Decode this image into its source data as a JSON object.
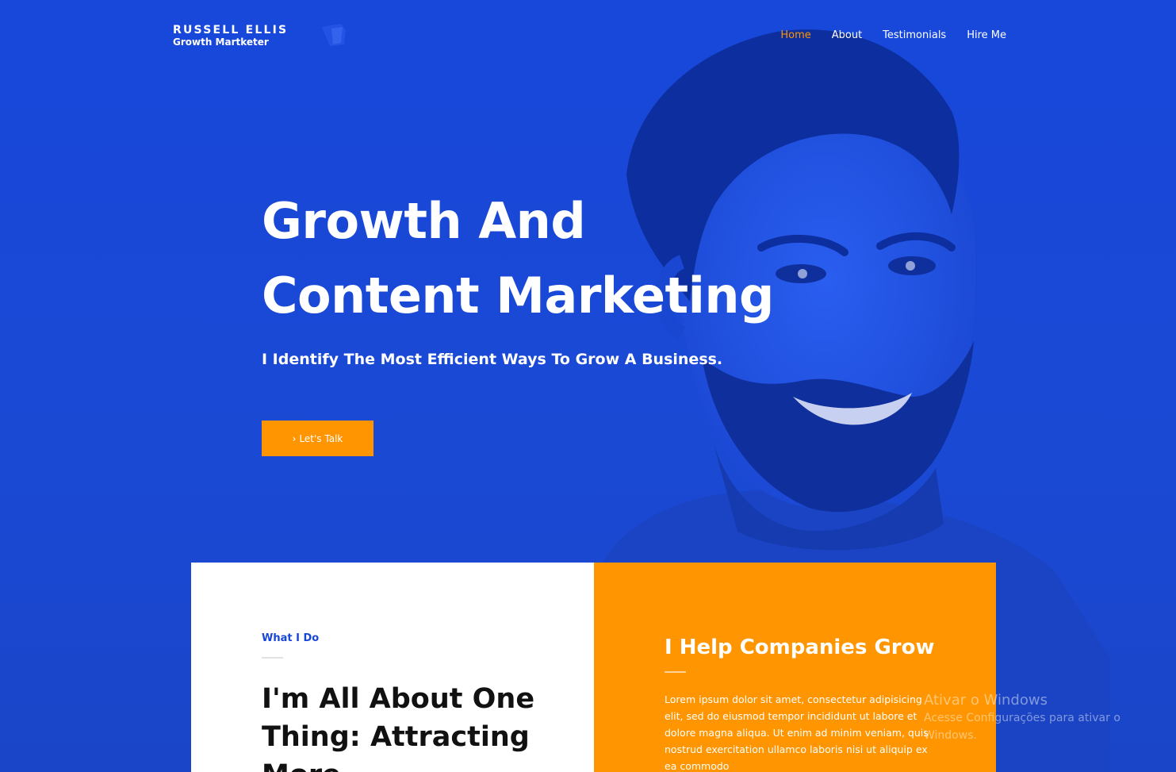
{
  "brand": {
    "name": "RUSSELL ELLIS",
    "tagline": "Growth Martketer"
  },
  "nav": {
    "items": [
      {
        "label": "Home",
        "active": true
      },
      {
        "label": "About",
        "active": false
      },
      {
        "label": "Testimonials",
        "active": false
      },
      {
        "label": "Hire Me",
        "active": false
      }
    ]
  },
  "hero": {
    "headline_line1": "Growth And",
    "headline_line2": "Content Marketing",
    "subheadline": "I Identify The Most Efficient Ways To Grow A Business.",
    "cta_icon": "chevron-right-icon",
    "cta_label": "Let's Talk"
  },
  "what_i_do": {
    "kicker": "What I Do",
    "title": "I'm All About One Thing: Attracting More"
  },
  "help": {
    "title": "I Help Companies Grow",
    "body": "Lorem ipsum dolor sit amet, consectetur adipisicing elit, sed do eiusmod tempor incididunt ut labore et dolore magna aliqua. Ut enim ad minim veniam, quis nostrud exercitation ullamco laboris nisi ut aliquip ex ea commodo"
  },
  "watermark": {
    "title": "Ativar o Windows",
    "subtitle": "Acesse Configurações para ativar o Windows."
  },
  "colors": {
    "primary_blue": "#1747d6",
    "accent_orange": "#ff9500",
    "text_dark": "#111111",
    "white": "#ffffff"
  }
}
